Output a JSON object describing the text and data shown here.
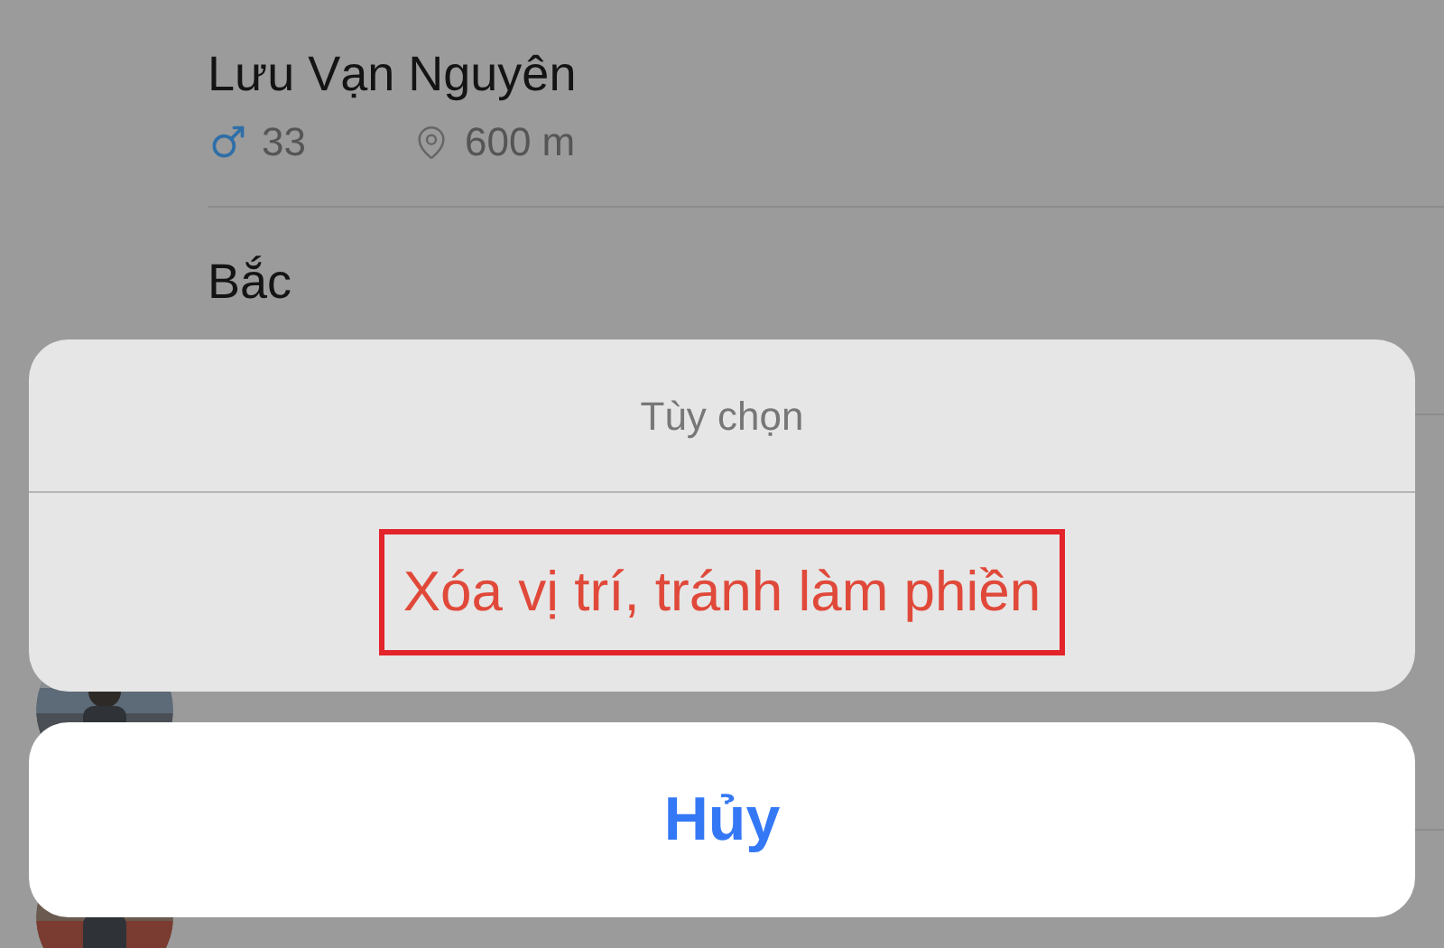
{
  "contacts": [
    {
      "name": "Lưu Vạn Nguyên",
      "avatar": false,
      "age": "33",
      "distance": "600 m"
    },
    {
      "name": "Bắc",
      "avatar": false
    },
    {
      "avatar": true
    },
    {
      "avatar": true
    }
  ],
  "action_sheet": {
    "title": "Tùy chọn",
    "actions": [
      {
        "label": "Xóa vị trí, tránh làm phiền",
        "highlighted": true
      }
    ],
    "cancel": "Hủy"
  }
}
